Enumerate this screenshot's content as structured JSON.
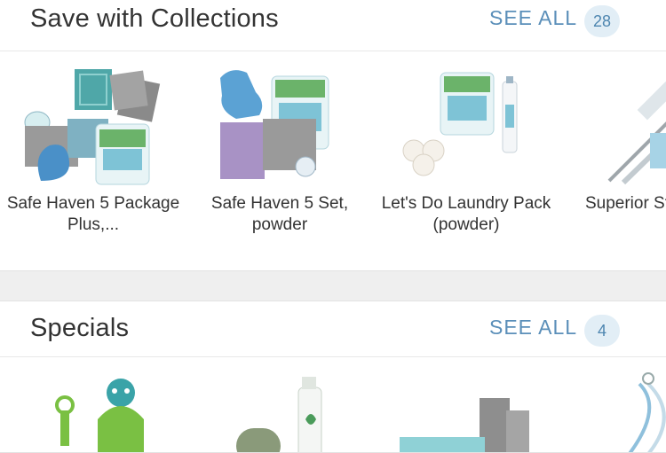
{
  "collections": {
    "title": "Save with Collections",
    "see_all": "SEE ALL",
    "count": "28",
    "items": [
      {
        "name": "Safe Haven 5 Package Plus,..."
      },
      {
        "name": "Safe Haven 5 Set, powder"
      },
      {
        "name": "Let's Do Laundry Pack (powder)"
      },
      {
        "name": "Superior Starter S"
      }
    ]
  },
  "specials": {
    "title": "Specials",
    "see_all": "SEE ALL",
    "count": "4"
  },
  "colors": {
    "accent": "#5b8fb9",
    "badge_bg": "#e2eef6",
    "page_bg": "#efefef"
  }
}
